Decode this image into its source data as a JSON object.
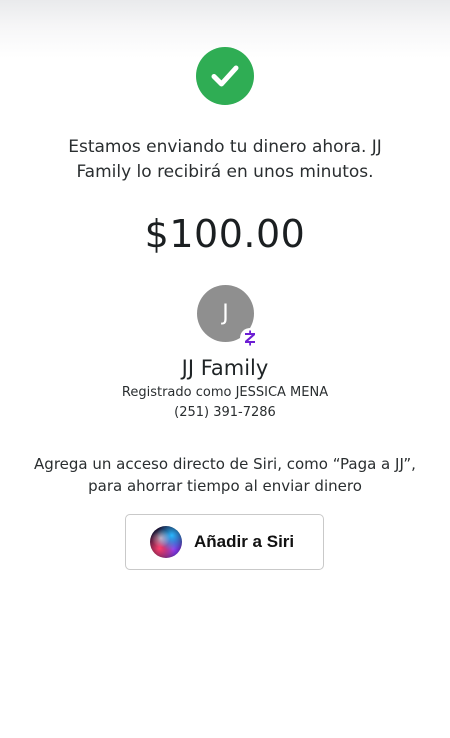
{
  "status": {
    "icon": "checkmark-icon",
    "color": "#2fad54",
    "message": "Estamos enviando tu dinero ahora. JJ Family lo recibirá en unos minutos."
  },
  "payment": {
    "amount": "$100.00"
  },
  "recipient": {
    "avatar_initial": "J",
    "avatar_color": "#8f8f8f",
    "badge_icon": "zelle-icon",
    "badge_color": "#6d1ed4",
    "name": "JJ Family",
    "registered_as": "Registrado como JESSICA MENA",
    "phone": "(251) 391-7286"
  },
  "siri": {
    "prompt": "Agrega un acceso directo de Siri, como “Paga a JJ”, para ahorrar tiempo al enviar dinero",
    "button_label": "Añadir a Siri",
    "button_icon": "siri-icon"
  }
}
